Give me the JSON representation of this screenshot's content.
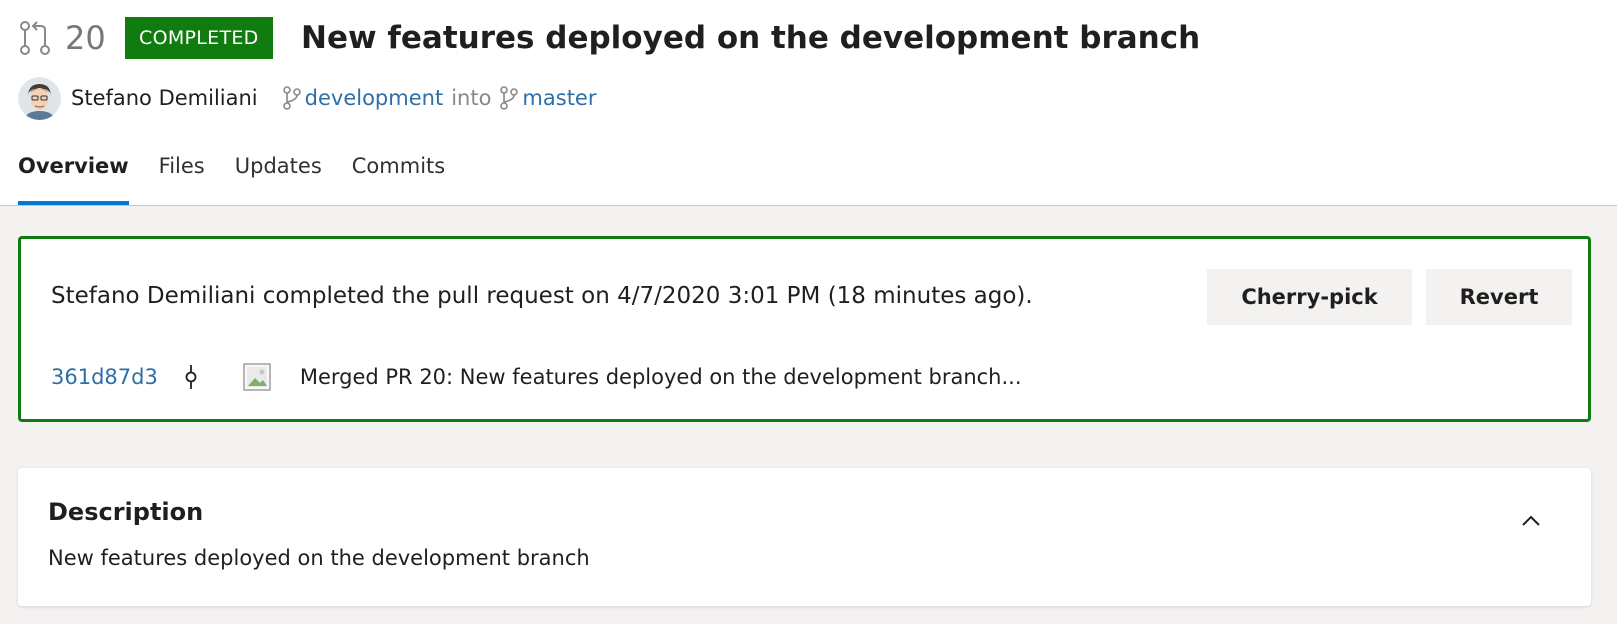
{
  "pull_request": {
    "number": "20",
    "status": "COMPLETED",
    "title": "New features deployed on the development branch",
    "author": "Stefano Demiliani",
    "source_branch": "development",
    "into_text": "into",
    "target_branch": "master"
  },
  "tabs": [
    {
      "label": "Overview",
      "active": true
    },
    {
      "label": "Files",
      "active": false
    },
    {
      "label": "Updates",
      "active": false
    },
    {
      "label": "Commits",
      "active": false
    }
  ],
  "completion": {
    "message": "Stefano Demiliani completed the pull request on 4/7/2020 3:01 PM (18 minutes ago).",
    "cherry_pick_label": "Cherry-pick",
    "revert_label": "Revert",
    "commit_id": "361d87d3",
    "commit_message": "Merged PR 20: New features deployed on the development branch..."
  },
  "description": {
    "title": "Description",
    "text": "New features deployed on the development branch"
  },
  "colors": {
    "status_green": "#107c10",
    "link_blue": "#2e6fa7",
    "tab_underline": "#0078d4"
  },
  "icons": {
    "pr": "pull-request-icon",
    "branch": "branch-icon",
    "commit": "commit-icon",
    "collapse": "chevron-up-icon"
  }
}
